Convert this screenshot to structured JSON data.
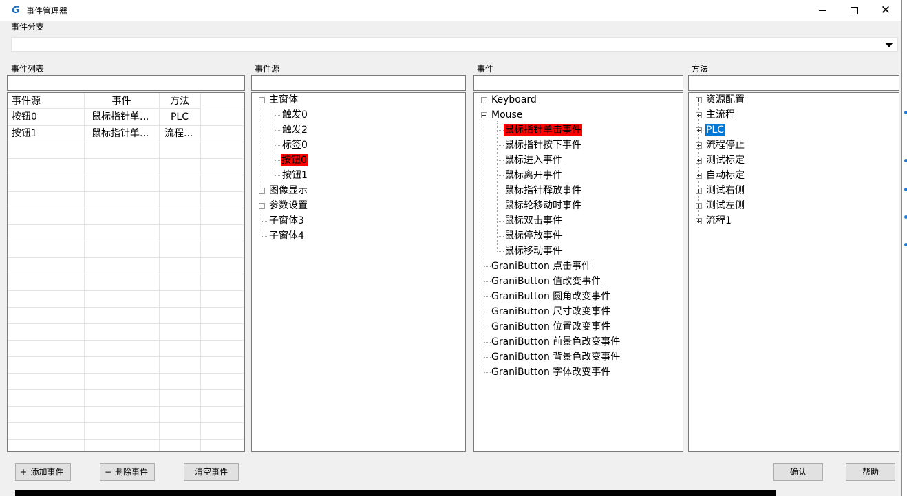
{
  "window": {
    "title": "事件管理器"
  },
  "branch": {
    "label": "事件分支",
    "value": ""
  },
  "event_list": {
    "label": "事件列表",
    "filter": "",
    "columns": [
      "事件源",
      "事件",
      "方法"
    ],
    "rows": [
      [
        "按钮0",
        "鼠标指针单...",
        "PLC"
      ],
      [
        "按钮1",
        "鼠标指针单...",
        "流程..."
      ]
    ]
  },
  "source": {
    "label": "事件源",
    "filter": "",
    "tree": {
      "root": "主窗体",
      "children": [
        "触发0",
        "触发2",
        "标签0",
        "按钮0",
        "按钮1"
      ],
      "others": [
        "图像显示",
        "参数设置",
        "子窗体3",
        "子窗体4"
      ]
    }
  },
  "events": {
    "label": "事件",
    "filter": "",
    "keyboard": "Keyboard",
    "mouse": "Mouse",
    "mouse_events": [
      "鼠标指针单击事件",
      "鼠标指针按下事件",
      "鼠标进入事件",
      "鼠标离开事件",
      "鼠标指针释放事件",
      "鼠标轮移动时事件",
      "鼠标双击事件",
      "鼠标停放事件",
      "鼠标移动事件"
    ],
    "grani_events": [
      "GraniButton 点击事件",
      "GraniButton 值改变事件",
      "GraniButton 圆角改变事件",
      "GraniButton 尺寸改变事件",
      "GraniButton 位置改变事件",
      "GraniButton 前景色改变事件",
      "GraniButton 背景色改变事件",
      "GraniButton 字体改变事件"
    ]
  },
  "methods": {
    "label": "方法",
    "filter": "",
    "items": [
      "资源配置",
      "主流程",
      "PLC",
      "流程停止",
      "测试标定",
      "自动标定",
      "测试右侧",
      "测试左侧",
      "流程1"
    ]
  },
  "buttons": {
    "add": "添加事件",
    "add_sym": "+",
    "delete": "删除事件",
    "delete_sym": "−",
    "clear": "清空事件",
    "confirm": "确认",
    "help": "帮助"
  },
  "colors": {
    "highlight_red": "#ff0000",
    "selection_blue": "#0078d7"
  }
}
